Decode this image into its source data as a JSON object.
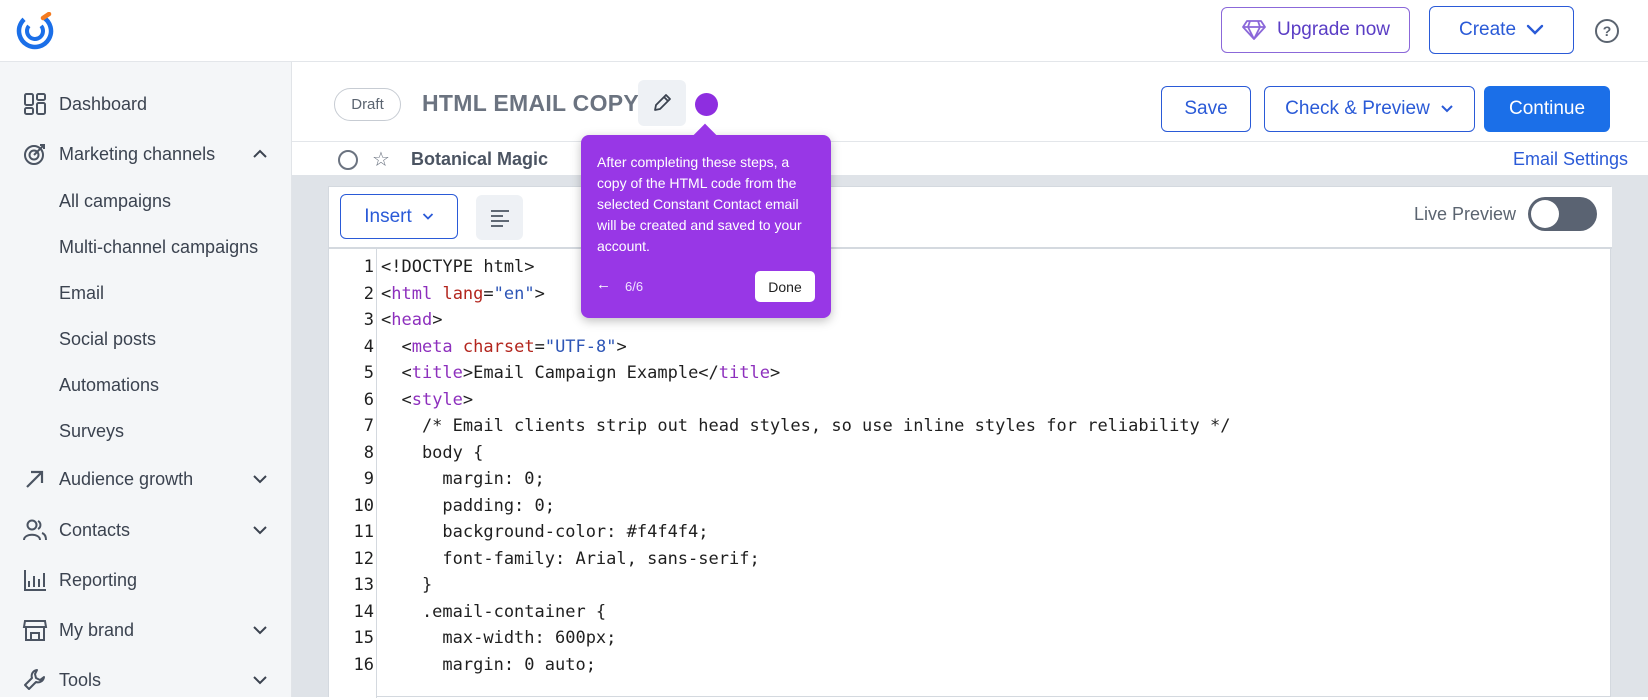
{
  "topbar": {
    "upgrade_label": "Upgrade now",
    "create_label": "Create",
    "help_glyph": "?"
  },
  "sidebar": {
    "dashboard": "Dashboard",
    "marketing_channels": "Marketing channels",
    "sub_items": [
      "All campaigns",
      "Multi-channel campaigns",
      "Email",
      "Social posts",
      "Automations",
      "Surveys"
    ],
    "audience_growth": "Audience growth",
    "contacts": "Contacts",
    "reporting": "Reporting",
    "my_brand": "My brand",
    "tools": "Tools"
  },
  "header": {
    "status": "Draft",
    "title": "HTML EMAIL COPY",
    "save_label": "Save",
    "check_preview_label": "Check & Preview",
    "continue_label": "Continue"
  },
  "campaign": {
    "name": "Botanical Magic",
    "settings_link": "Email Settings"
  },
  "editor": {
    "insert_label": "Insert",
    "live_preview_label": "Live Preview",
    "live_preview_on": false
  },
  "code_lines": [
    "<!DOCTYPE html>",
    "<html lang=\"en\">",
    "<head>",
    "  <meta charset=\"UTF-8\">",
    "  <title>Email Campaign Example</title>",
    "  <style>",
    "    /* Email clients strip out head styles, so use inline styles for reliability */",
    "    body {",
    "      margin: 0;",
    "      padding: 0;",
    "      background-color: #f4f4f4;",
    "      font-family: Arial, sans-serif;",
    "    }",
    "    .email-container {",
    "      max-width: 600px;",
    "      margin: 0 auto;"
  ],
  "tooltip": {
    "message": "After completing these steps, a copy of the HTML code from the selected Constant Contact email will be created and saved to your account.",
    "back_glyph": "←",
    "step": "6/6",
    "done_label": "Done"
  },
  "colors": {
    "primary": "#1b6fe8",
    "accent_purple": "#9837e6",
    "sidebar_bg": "#f4f6f8"
  }
}
